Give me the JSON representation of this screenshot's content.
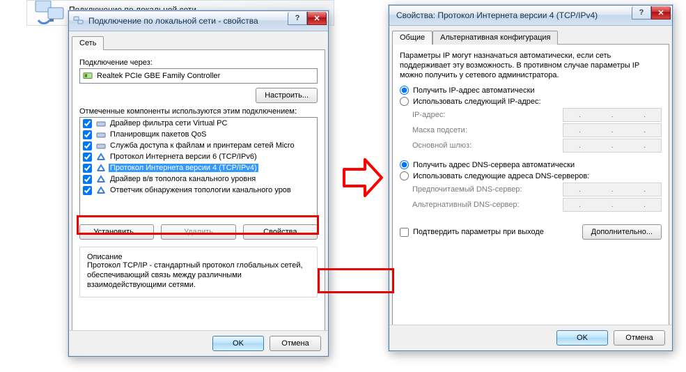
{
  "bg": {
    "label": "Подключение по локальной сети"
  },
  "left": {
    "title": "Подключение по локальной сети - свойства",
    "tab": "Сеть",
    "connect_via_label": "Подключение через:",
    "adapter": "Realtek PCIe GBE Family Controller",
    "configure_btn": "Настроить...",
    "components_label": "Отмеченные компоненты используются этим подключением:",
    "items": [
      "Драйвер фильтра сети Virtual PC",
      "Планировщик пакетов QoS",
      "Служба доступа к файлам и принтерам сетей Micro",
      "Протокол Интернета версии 6 (TCP/IPv6)",
      "Протокол Интернета версии 4 (TCP/IPv4)",
      "Драйвер в/в тополога канального уровня",
      "Ответчик обнаружения топологии канального уров"
    ],
    "install_btn": "Установить...",
    "remove_btn": "Удалить",
    "props_btn": "Свойства",
    "desc_heading": "Описание",
    "desc_text": "Протокол TCP/IP - стандартный протокол глобальных сетей, обеспечивающий связь между различными взаимодействующими сетями.",
    "ok": "OK",
    "cancel": "Отмена"
  },
  "right": {
    "title": "Свойства: Протокол Интернета версии 4 (TCP/IPv4)",
    "tab_general": "Общие",
    "tab_alt": "Альтернативная конфигурация",
    "intro": "Параметры IP могут назначаться автоматически, если сеть поддерживает эту возможность. В противном случае параметры IP можно получить у сетевого администратора.",
    "ip_auto": "Получить IP-адрес автоматически",
    "ip_manual": "Использовать следующий IP-адрес:",
    "ip_addr_lbl": "IP-адрес:",
    "mask_lbl": "Маска подсети:",
    "gw_lbl": "Основной шлюз:",
    "dns_auto": "Получить адрес DNS-сервера автоматически",
    "dns_manual": "Использовать следующие адреса DNS-серверов:",
    "dns_pref_lbl": "Предпочитаемый DNS-сервер:",
    "dns_alt_lbl": "Альтернативный DNS-сервер:",
    "validate_lbl": "Подтвердить параметры при выходе",
    "advanced_btn": "Дополнительно...",
    "ok": "OK",
    "cancel": "Отмена"
  }
}
